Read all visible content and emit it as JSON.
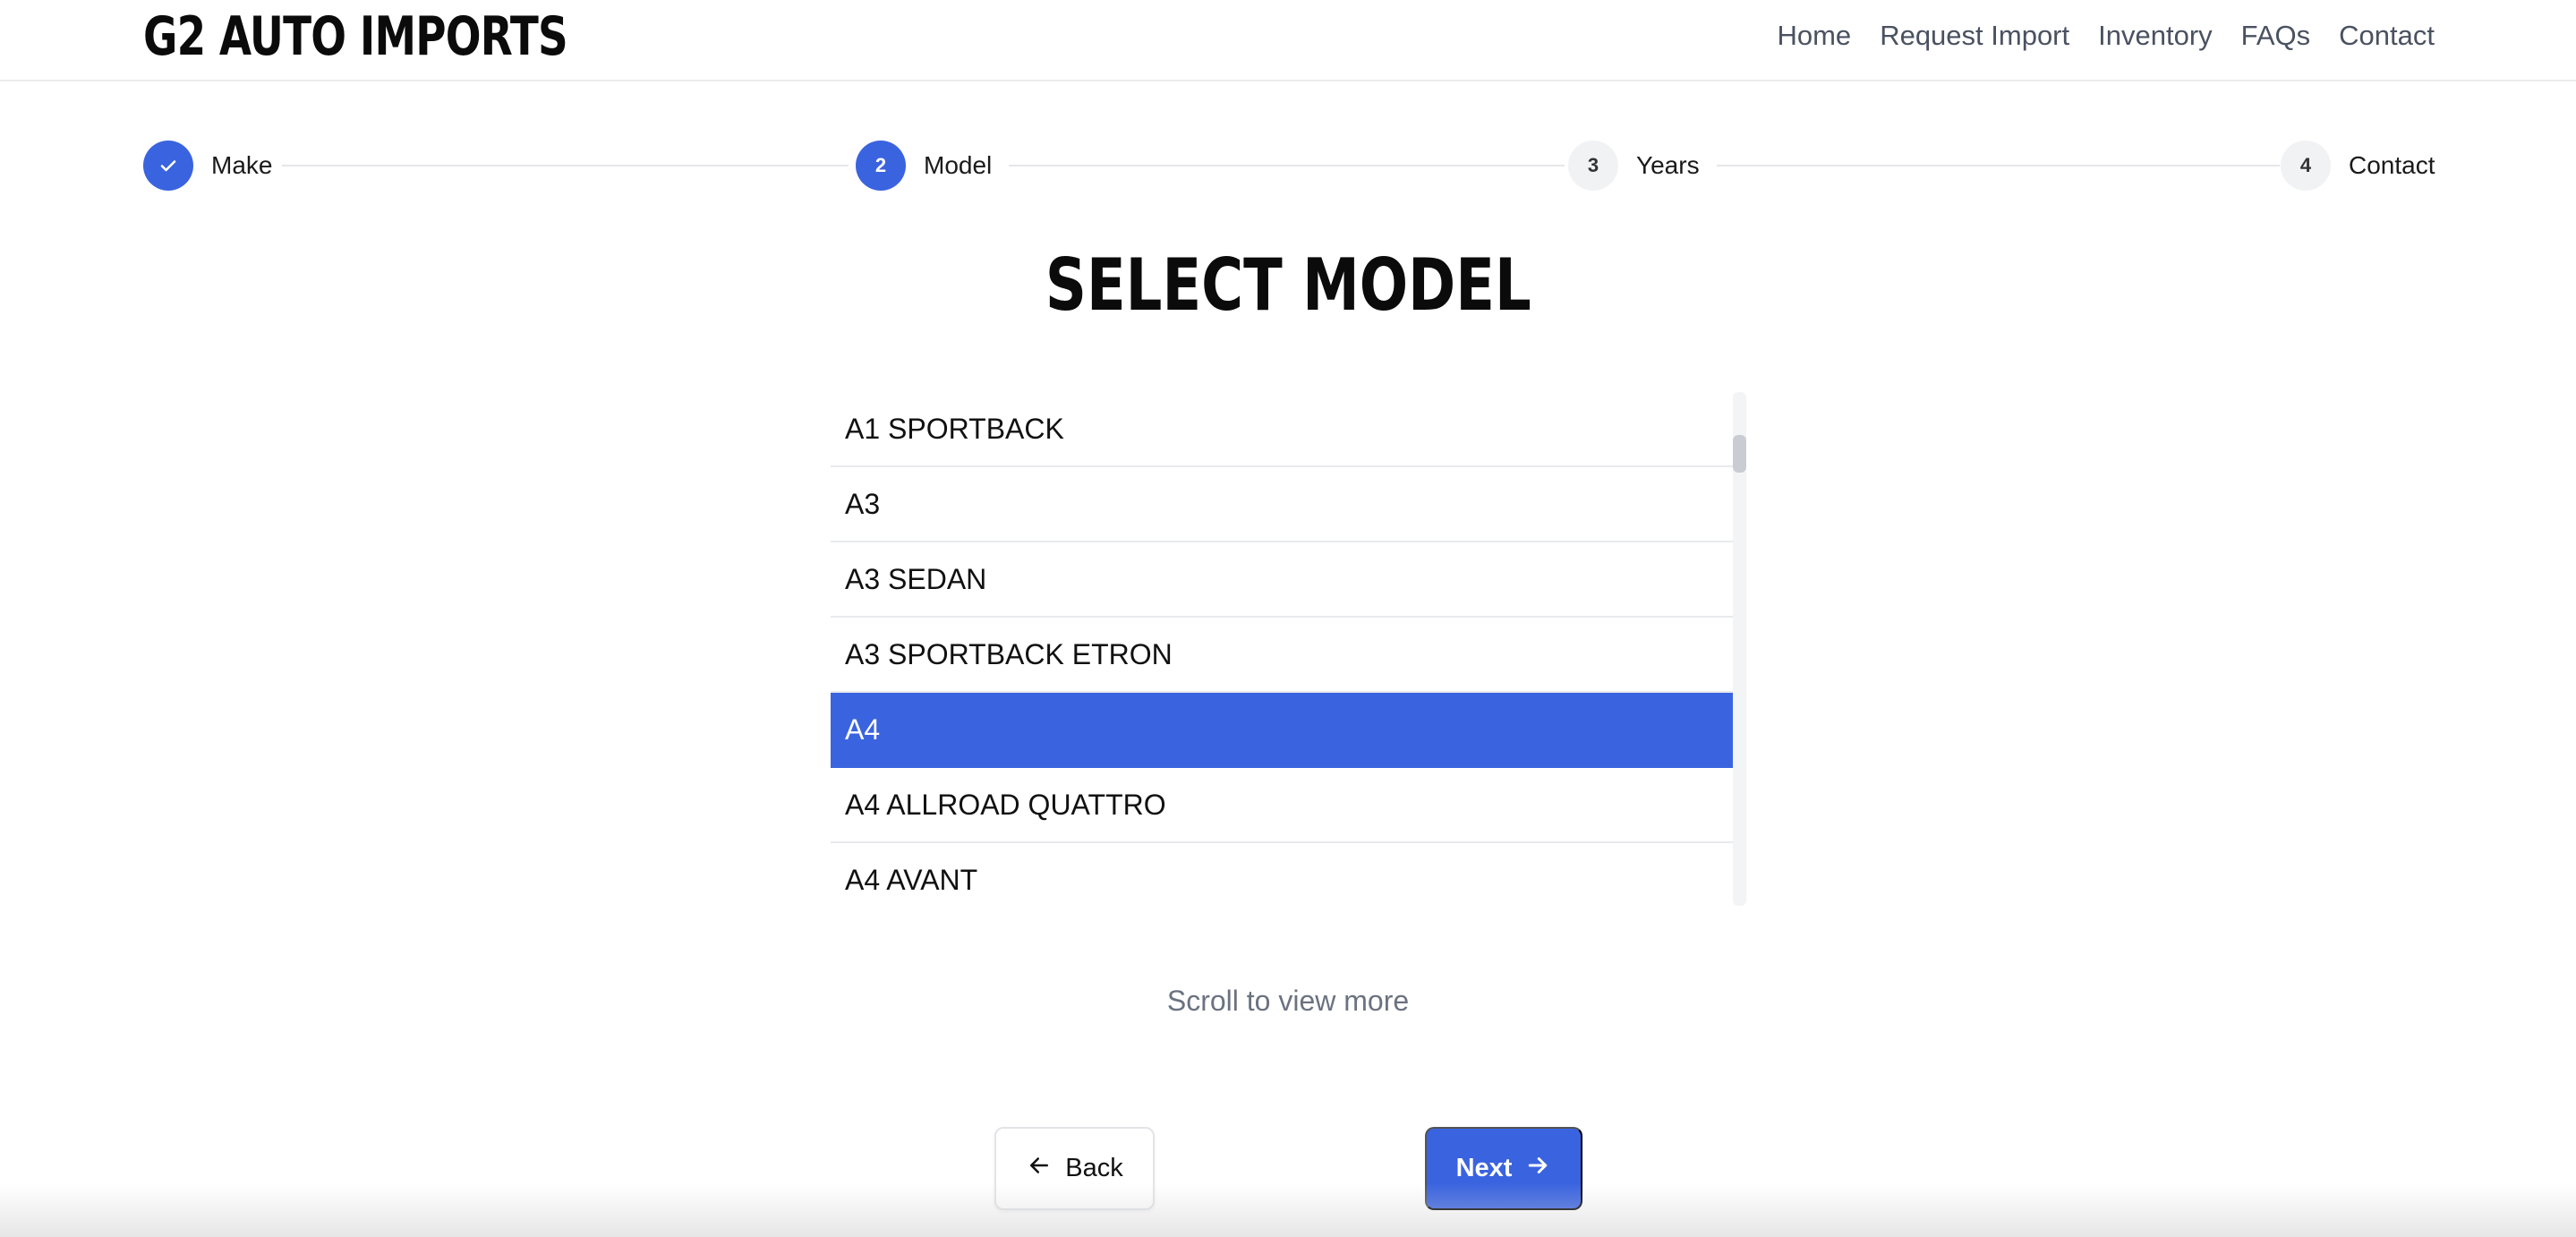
{
  "brand": {
    "logo": "G2 AUTO IMPORTS"
  },
  "nav": {
    "items": [
      "Home",
      "Request Import",
      "Inventory",
      "FAQs",
      "Contact"
    ]
  },
  "stepper": {
    "steps": [
      {
        "number": "",
        "label": "Make",
        "state": "complete",
        "icon": "check-icon"
      },
      {
        "number": "2",
        "label": "Model",
        "state": "active"
      },
      {
        "number": "3",
        "label": "Years",
        "state": "pending"
      },
      {
        "number": "4",
        "label": "Contact",
        "state": "pending"
      }
    ]
  },
  "main": {
    "title": "SELECT MODEL",
    "models": [
      "A1 SPORTBACK",
      "A3",
      "A3 SEDAN",
      "A3 SPORTBACK ETRON",
      "A4",
      "A4 ALLROAD QUATTRO",
      "A4 AVANT"
    ],
    "selected_model": "A4",
    "scroll_hint": "Scroll to view more"
  },
  "actions": {
    "back_label": "Back",
    "back_icon": "arrow-left-icon",
    "next_label": "Next",
    "next_icon": "arrow-right-icon"
  },
  "colors": {
    "accent": "#3a63e0"
  }
}
